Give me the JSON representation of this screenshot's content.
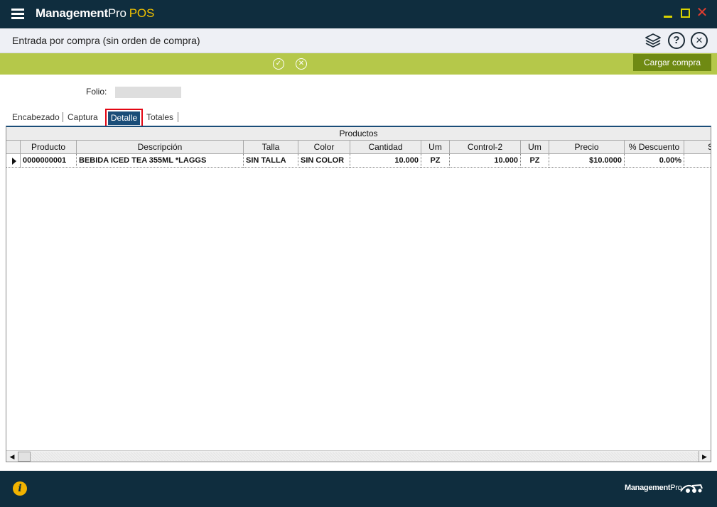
{
  "titlebar": {
    "app_name": "Management",
    "app_name_suffix": "Pro",
    "app_product": "POS"
  },
  "header": {
    "page_title": "Entrada por compra (sin orden de compra)"
  },
  "actionbar": {
    "cargar_label": "Cargar compra"
  },
  "form": {
    "folio_label": "Folio:",
    "folio_value": ""
  },
  "tabs": [
    {
      "label": "Encabezado"
    },
    {
      "label": "Captura"
    },
    {
      "label": "Detalle",
      "active": true
    },
    {
      "label": "Totales"
    }
  ],
  "grid": {
    "band_title": "Productos",
    "columns": [
      "Producto",
      "Descripción",
      "Talla",
      "Color",
      "Cantidad",
      "Um",
      "Control-2",
      "Um",
      "Precio",
      "% Descuento",
      "S"
    ],
    "rows": [
      [
        "0000000001",
        "BEBIDA ICED TEA 355ML *LAGGS",
        "SIN TALLA",
        "SIN COLOR",
        "10.000",
        "PZ",
        "10.000",
        "PZ",
        "$10.0000",
        "0.00%",
        ""
      ]
    ]
  },
  "footer": {
    "brand": "Management",
    "brand_suffix": "Pro"
  },
  "colors": {
    "titlebar_bg": "#0f2d3e",
    "action_bar": "#b5c84a",
    "cargar_button": "#6f8a13",
    "active_tab": "#1a4d78",
    "highlight_border": "#e30613",
    "pos_accent": "#f2c200"
  }
}
